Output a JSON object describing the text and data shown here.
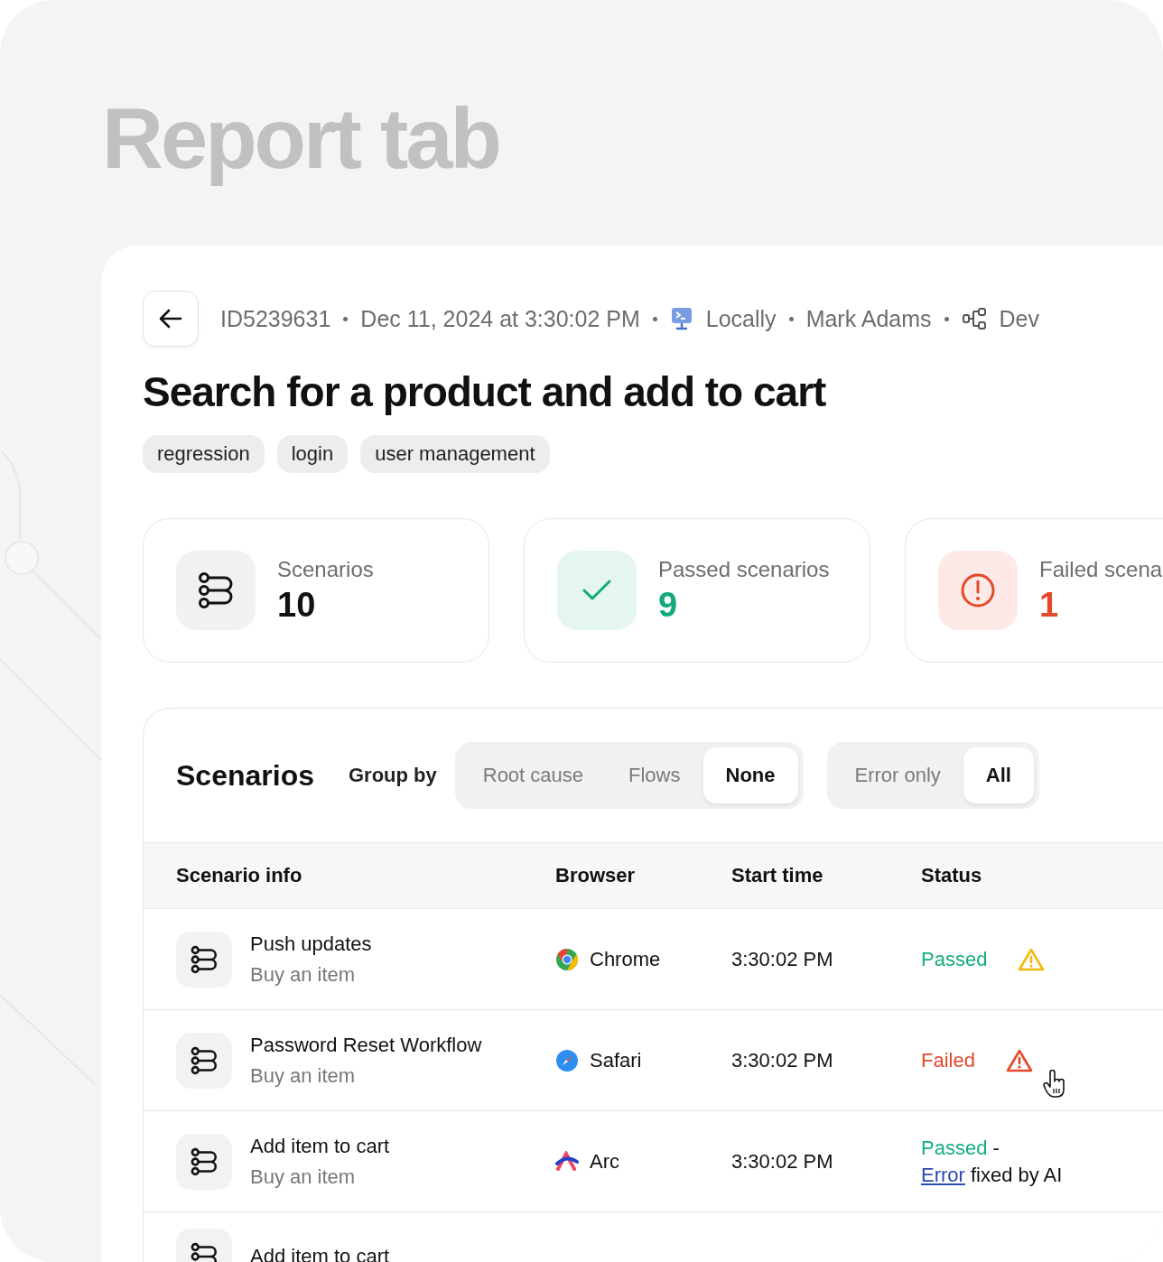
{
  "page_title": "Report tab",
  "meta": {
    "id": "ID5239631",
    "date": "Dec 11, 2024 at 3:30:02 PM",
    "environment": "Locally",
    "user": "Mark Adams",
    "branch": "Dev"
  },
  "title": "Search for a product and add to cart",
  "tags": [
    "regression",
    "login",
    "user management"
  ],
  "stats": [
    {
      "kind": "total",
      "label": "Scenarios",
      "value": "10"
    },
    {
      "kind": "passed",
      "label": "Passed scenarios",
      "value": "9"
    },
    {
      "kind": "failed",
      "label": "Failed scena",
      "value": "1"
    }
  ],
  "scenarios": {
    "title": "Scenarios",
    "group_by_label": "Group by",
    "group_options": [
      {
        "label": "Root cause",
        "selected": false
      },
      {
        "label": "Flows",
        "selected": false
      },
      {
        "label": "None",
        "selected": true
      }
    ],
    "filter_options": [
      {
        "label": "Error only",
        "selected": false
      },
      {
        "label": "All",
        "selected": true
      }
    ],
    "columns": [
      "Scenario info",
      "Browser",
      "Start time",
      "Status"
    ],
    "rows": [
      {
        "name": "Push updates",
        "flow": "Buy an item",
        "browser": {
          "kind": "chrome",
          "name": "Chrome"
        },
        "start_time": "3:30:02 PM",
        "status": {
          "kind": "passed",
          "text": "Passed",
          "warning": true
        },
        "hovered": false
      },
      {
        "name": "Password Reset Workflow",
        "flow": "Buy an item",
        "browser": {
          "kind": "safari",
          "name": "Safari"
        },
        "start_time": "3:30:02 PM",
        "status": {
          "kind": "failed",
          "text": "Failed",
          "warning": true
        },
        "hovered": true
      },
      {
        "name": "Add item to cart",
        "flow": "Buy an item",
        "browser": {
          "kind": "arc",
          "name": "Arc"
        },
        "start_time": "3:30:02 PM",
        "status": {
          "kind": "passed",
          "text": "Passed",
          "warning": false,
          "suffix": "-",
          "link": "Error",
          "note": "fixed by AI"
        },
        "hovered": false
      },
      {
        "name": "Add item to cart"
      }
    ]
  }
}
